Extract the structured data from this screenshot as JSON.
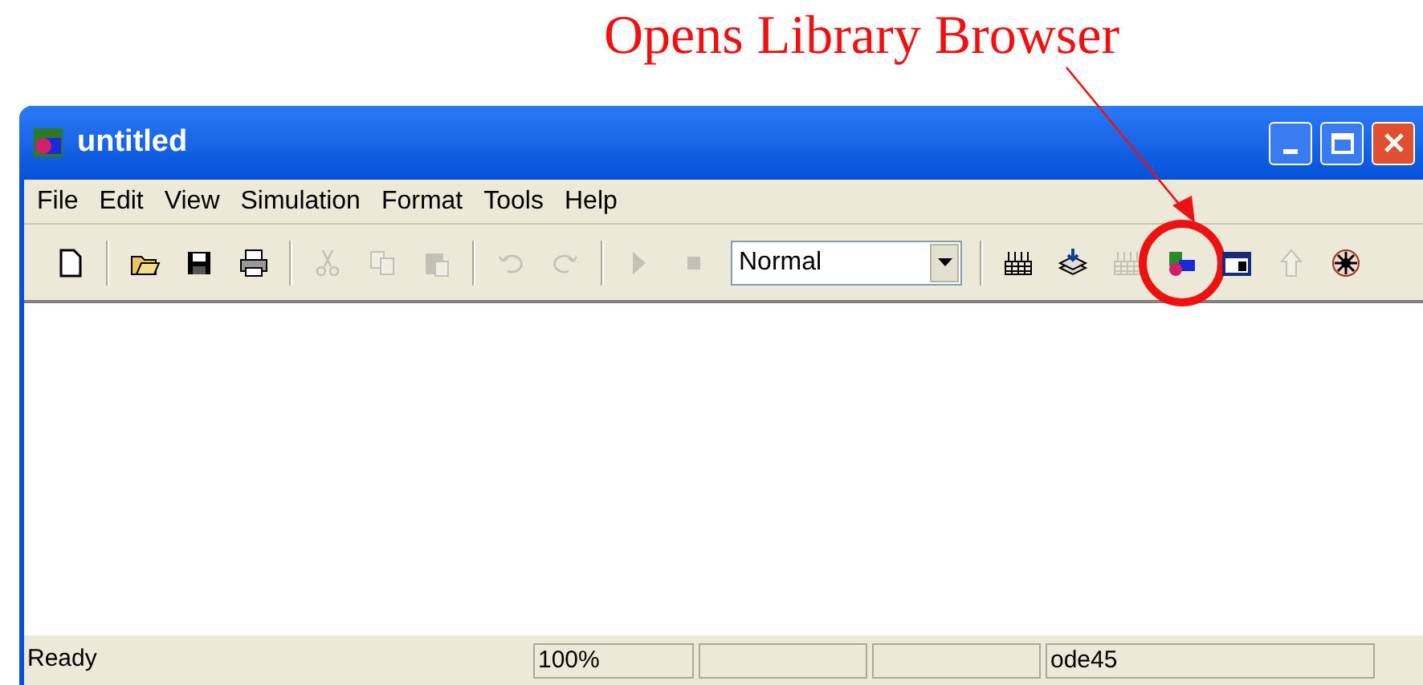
{
  "annotation": {
    "text": "Opens Library Browser"
  },
  "window": {
    "title": "untitled"
  },
  "menu": [
    {
      "label": "File"
    },
    {
      "label": "Edit"
    },
    {
      "label": "View"
    },
    {
      "label": "Simulation"
    },
    {
      "label": "Format"
    },
    {
      "label": "Tools"
    },
    {
      "label": "Help"
    }
  ],
  "toolbar": {
    "items": [
      {
        "kind": "new",
        "disabled": false,
        "highlighted": false
      },
      {
        "kind": "separator"
      },
      {
        "kind": "open",
        "disabled": false,
        "highlighted": false
      },
      {
        "kind": "save",
        "disabled": false,
        "highlighted": false
      },
      {
        "kind": "print",
        "disabled": false,
        "highlighted": false
      },
      {
        "kind": "separator"
      },
      {
        "kind": "cut",
        "disabled": true,
        "highlighted": false
      },
      {
        "kind": "copy",
        "disabled": true,
        "highlighted": false
      },
      {
        "kind": "paste",
        "disabled": true,
        "highlighted": false
      },
      {
        "kind": "separator"
      },
      {
        "kind": "undo",
        "disabled": true,
        "highlighted": false
      },
      {
        "kind": "redo",
        "disabled": true,
        "highlighted": false
      },
      {
        "kind": "separator"
      },
      {
        "kind": "play",
        "disabled": true,
        "highlighted": false
      },
      {
        "kind": "stop",
        "disabled": true,
        "highlighted": false
      },
      {
        "kind": "combo",
        "value": "Normal"
      },
      {
        "kind": "separator"
      },
      {
        "kind": "build",
        "disabled": false,
        "highlighted": false
      },
      {
        "kind": "update",
        "disabled": false,
        "highlighted": false
      },
      {
        "kind": "build",
        "disabled": true,
        "highlighted": false
      },
      {
        "kind": "library",
        "disabled": false,
        "highlighted": true
      },
      {
        "kind": "explorer",
        "disabled": false,
        "highlighted": false
      },
      {
        "kind": "up",
        "disabled": true,
        "highlighted": false
      },
      {
        "kind": "debug",
        "disabled": false,
        "highlighted": false
      }
    ]
  },
  "status_bar": {
    "panes": [
      {
        "kind": "text",
        "text": "Ready"
      },
      {
        "kind": "text",
        "text": "100%"
      },
      {
        "kind": "blank"
      },
      {
        "kind": "blank"
      },
      {
        "kind": "text",
        "text": "ode45"
      }
    ]
  }
}
